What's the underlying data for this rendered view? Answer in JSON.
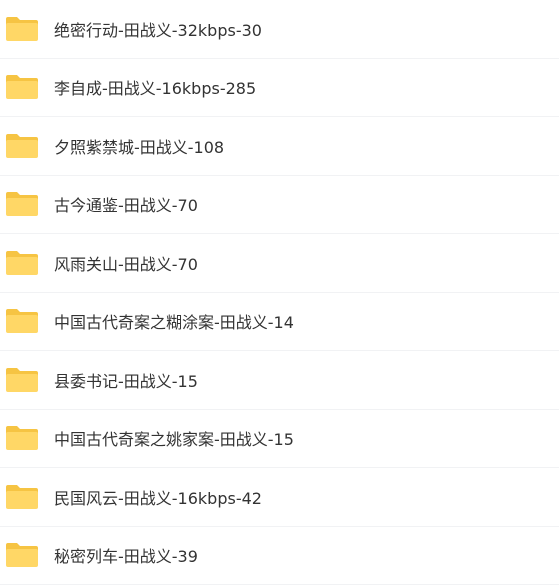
{
  "colors": {
    "folder_body": "#ffd766",
    "folder_back": "#f6c443",
    "text": "#333333",
    "divider": "#f1f2f4"
  },
  "folders": [
    {
      "name": "绝密行动-田战义-32kbps-30",
      "icon": "folder-icon"
    },
    {
      "name": "李自成-田战义-16kbps-285",
      "icon": "folder-icon"
    },
    {
      "name": "夕照紫禁城-田战义-108",
      "icon": "folder-icon"
    },
    {
      "name": "古今通鉴-田战义-70",
      "icon": "folder-icon"
    },
    {
      "name": "风雨关山-田战义-70",
      "icon": "folder-icon"
    },
    {
      "name": "中国古代奇案之糊涂案-田战义-14",
      "icon": "folder-icon"
    },
    {
      "name": "县委书记-田战义-15",
      "icon": "folder-icon"
    },
    {
      "name": "中国古代奇案之姚家案-田战义-15",
      "icon": "folder-icon"
    },
    {
      "name": "民国风云-田战义-16kbps-42",
      "icon": "folder-icon"
    },
    {
      "name": "秘密列车-田战义-39",
      "icon": "folder-icon"
    }
  ]
}
